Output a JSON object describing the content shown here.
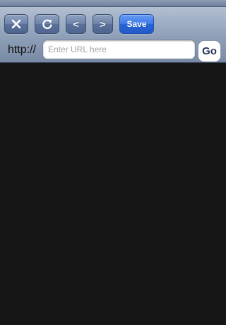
{
  "toolbar": {
    "close_icon": "close-icon",
    "reload_icon": "reload-icon",
    "back_label": "<",
    "forward_label": ">",
    "save_label": "Save"
  },
  "address_bar": {
    "scheme": "http://",
    "placeholder": "Enter URL here",
    "value": "",
    "go_label": "Go"
  },
  "colors": {
    "toolbar_top": "#b2bfd1",
    "toolbar_bottom": "#7889a4",
    "nav_button": "#5a7299",
    "save_button": "#2a64d6",
    "content_background": "#161616"
  }
}
